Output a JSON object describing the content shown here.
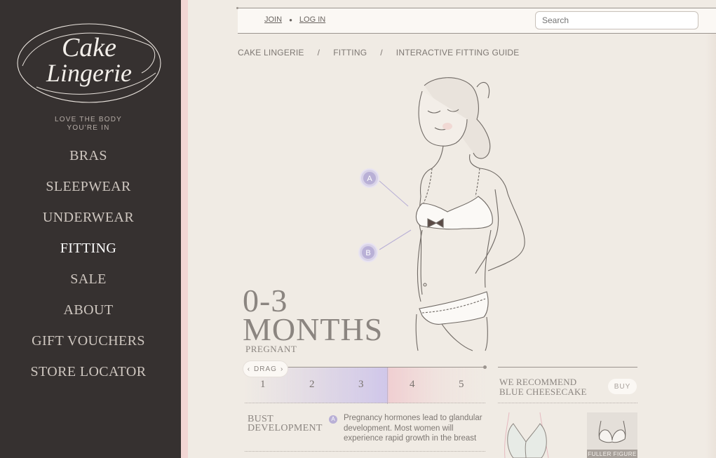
{
  "brand": {
    "logo_text_top": "Cake",
    "logo_text_bottom": "Lingerie",
    "tagline_line1": "LOVE THE BODY",
    "tagline_line2": "YOU'RE IN"
  },
  "nav": {
    "items": [
      {
        "label": "BRAS"
      },
      {
        "label": "SLEEPWEAR"
      },
      {
        "label": "UNDERWEAR"
      },
      {
        "label": "FITTING",
        "active": true
      },
      {
        "label": "SALE"
      },
      {
        "label": "ABOUT"
      },
      {
        "label": "GIFT VOUCHERS"
      },
      {
        "label": "STORE LOCATOR"
      }
    ]
  },
  "topbar": {
    "join_label": "JOIN",
    "login_label": "LOG IN",
    "search_placeholder": "Search"
  },
  "breadcrumb": {
    "items": [
      "CAKE LINGERIE",
      "FITTING",
      "INTERACTIVE FITTING GUIDE"
    ],
    "separator": "/"
  },
  "figure": {
    "point_a": "A",
    "point_b": "B"
  },
  "stage": {
    "title_line1": "0-3",
    "title_line2": "MONTHS",
    "subtitle": "PREGNANT"
  },
  "timeline": {
    "drag_label": "DRAG",
    "ticks": [
      "1",
      "2",
      "3",
      "4",
      "5"
    ]
  },
  "bust": {
    "title_line1": "BUST",
    "title_line2": "DEVELOPMENT",
    "badge": "A",
    "description": "Pregnancy hormones lead to glandular development. Most women will experience rapid growth in the breast"
  },
  "recommend": {
    "title_line1": "WE RECOMMEND",
    "title_line2": "BLUE CHEESECAKE",
    "buy_label": "BUY",
    "thumb_label": "FULLER FIGURE"
  },
  "colors": {
    "sidebar": "#363130",
    "accent_pink": "#f2d6d4",
    "accent_lavender": "#b9b0d6",
    "page_bg": "#f0ebe4"
  }
}
